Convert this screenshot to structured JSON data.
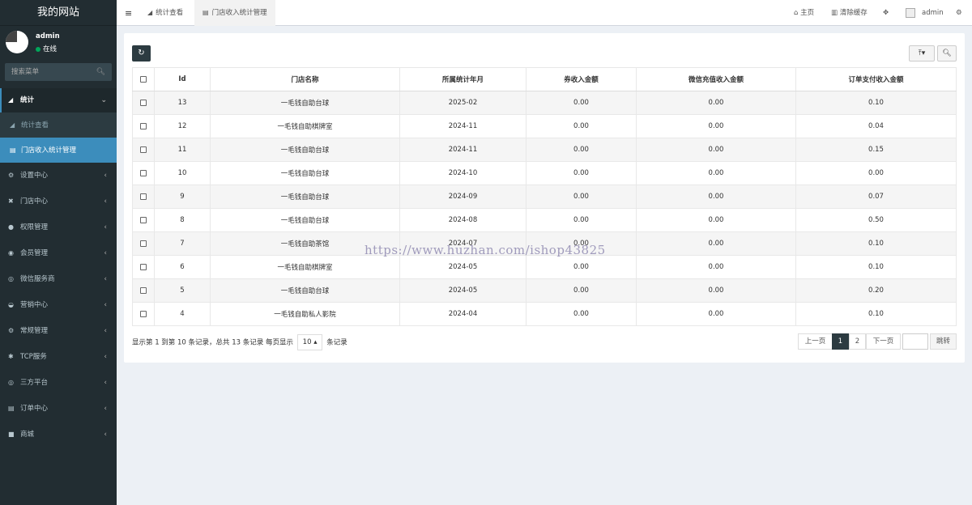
{
  "logo": "我的网站",
  "user": {
    "name": "admin",
    "status": "在线"
  },
  "search": {
    "placeholder": "搜索菜单"
  },
  "menu": {
    "open_section": {
      "label": "统计",
      "icon": "area-chart-icon"
    },
    "sub_items": [
      {
        "label": "统计查看",
        "icon": "area-chart-icon"
      },
      {
        "label": "门店收入统计管理",
        "icon": "table-icon"
      }
    ],
    "items": [
      {
        "label": "设置中心",
        "icon": "cogs-icon"
      },
      {
        "label": "门店中心",
        "icon": "store-icon"
      },
      {
        "label": "权限管理",
        "icon": "users-icon"
      },
      {
        "label": "会员管理",
        "icon": "user-circle-icon"
      },
      {
        "label": "微信服务商",
        "icon": "wechat-icon"
      },
      {
        "label": "营销中心",
        "icon": "dashboard-icon"
      },
      {
        "label": "常规管理",
        "icon": "cogs-icon"
      },
      {
        "label": "TCP服务",
        "icon": "asterisk-icon"
      },
      {
        "label": "三方平台",
        "icon": "eye-icon"
      },
      {
        "label": "订单中心",
        "icon": "list-icon"
      },
      {
        "label": "商城",
        "icon": "briefcase-icon"
      }
    ]
  },
  "topbar": {
    "tabs": [
      {
        "label": "统计查看",
        "icon": "area-chart-icon"
      },
      {
        "label": "门店收入统计管理",
        "icon": "table-icon"
      }
    ],
    "home": "主页",
    "clear_cache": "清除缓存",
    "user": "admin"
  },
  "table": {
    "headers": [
      "Id",
      "门店名称",
      "所属统计年月",
      "券收入金额",
      "微信充值收入金额",
      "订单支付收入金额"
    ],
    "rows": [
      [
        "13",
        "一毛钱自助台球",
        "2025-02",
        "0.00",
        "0.00",
        "0.10"
      ],
      [
        "12",
        "一毛钱自助棋牌室",
        "2024-11",
        "0.00",
        "0.00",
        "0.04"
      ],
      [
        "11",
        "一毛钱自助台球",
        "2024-11",
        "0.00",
        "0.00",
        "0.15"
      ],
      [
        "10",
        "一毛钱自助台球",
        "2024-10",
        "0.00",
        "0.00",
        "0.00"
      ],
      [
        "9",
        "一毛钱自助台球",
        "2024-09",
        "0.00",
        "0.00",
        "0.07"
      ],
      [
        "8",
        "一毛钱自助台球",
        "2024-08",
        "0.00",
        "0.00",
        "0.50"
      ],
      [
        "7",
        "一毛钱自助茶馆",
        "2024-07",
        "0.00",
        "0.00",
        "0.10"
      ],
      [
        "6",
        "一毛钱自助棋牌室",
        "2024-05",
        "0.00",
        "0.00",
        "0.10"
      ],
      [
        "5",
        "一毛钱自助台球",
        "2024-05",
        "0.00",
        "0.00",
        "0.20"
      ],
      [
        "4",
        "一毛钱自助私人影院",
        "2024-04",
        "0.00",
        "0.00",
        "0.10"
      ]
    ]
  },
  "footer": {
    "info": "显示第 1 到第 10 条记录，总共 13 条记录 每页显示",
    "page_size": "10",
    "suffix": "条记录"
  },
  "pagination": {
    "prev": "上一页",
    "pages": [
      "1",
      "2"
    ],
    "current": "1",
    "next": "下一页",
    "jump": "跳转"
  },
  "watermark": "https://www.huzhan.com/ishop43825"
}
